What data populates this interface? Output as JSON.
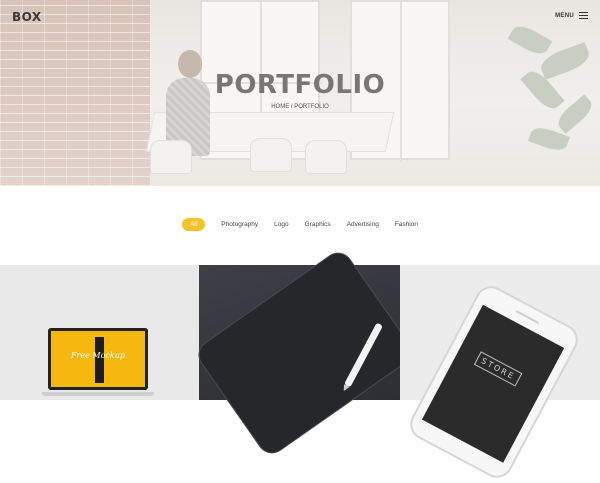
{
  "header": {
    "logo": "BOX",
    "menu_label": "MENU"
  },
  "hero": {
    "title": "PORTFOLIO",
    "breadcrumb": {
      "home": "HOME",
      "separator": "/",
      "current": "PORTFOLIO"
    }
  },
  "filters": [
    {
      "label": "All",
      "active": true
    },
    {
      "label": "Photography",
      "active": false
    },
    {
      "label": "Logo",
      "active": false
    },
    {
      "label": "Graphics",
      "active": false
    },
    {
      "label": "Advertising",
      "active": false
    },
    {
      "label": "Fashion",
      "active": false
    }
  ],
  "portfolio": {
    "items": [
      {
        "mockup_text": "Free Mockup"
      },
      {},
      {
        "mockup_text": "STORE"
      }
    ]
  },
  "colors": {
    "accent": "#f6c22c",
    "title_gray": "#777777",
    "dark_tile": "#3a3b41"
  },
  "icons": {
    "menu": "hamburger-icon"
  }
}
